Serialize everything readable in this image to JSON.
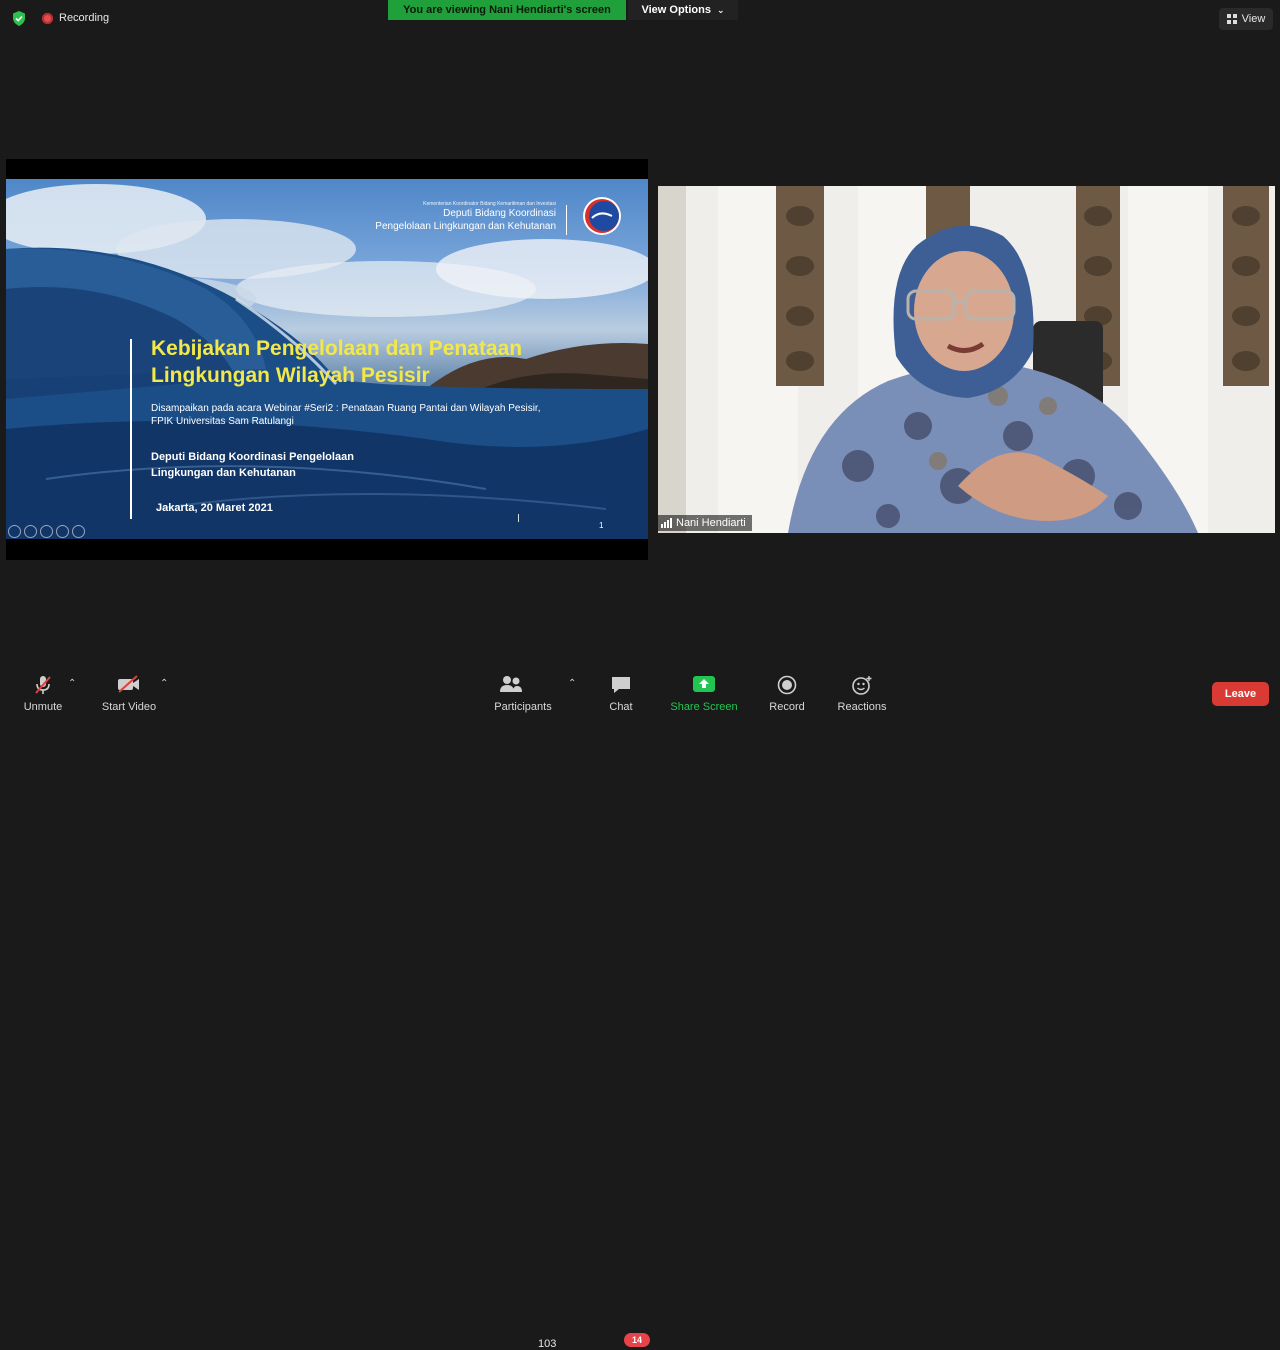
{
  "topbar": {
    "recording_label": "Recording",
    "viewing_banner": "You are viewing Nani Hendiarti's screen",
    "view_options_label": "View Options",
    "view_label": "View"
  },
  "slide": {
    "org_small": "Kementerian Koordinator Bidang Kemaritiman dan Investasi",
    "org_line1": "Deputi Bidang Koordinasi",
    "org_line2": "Pengelolaan Lingkungan dan Kehutanan",
    "title_line1": "Kebijakan Pengelolaan dan Penataan",
    "title_line2": "Lingkungan Wilayah Pesisir",
    "sub_line1": "Disampaikan pada acara Webinar #Seri2 : Penataan Ruang Pantai dan Wilayah Pesisir,",
    "sub_line2": "FPIK Universitas Sam Ratulangi",
    "dept_line1": "Deputi Bidang Koordinasi Pengelolaan",
    "dept_line2": "Lingkungan dan Kehutanan",
    "date": "Jakarta, 20 Maret 2021",
    "page_number": "1"
  },
  "participant": {
    "name": "Nani Hendiarti"
  },
  "toolbar": {
    "unmute": "Unmute",
    "start_video": "Start Video",
    "participants": "Participants",
    "participant_count": "103",
    "chat": "Chat",
    "chat_badge": "14",
    "share_screen": "Share Screen",
    "record": "Record",
    "reactions": "Reactions",
    "leave": "Leave"
  },
  "colors": {
    "banner_green": "#1fa03a",
    "leave_red": "#d93a34",
    "share_green": "#23c552",
    "title_yellow": "#f2e84a"
  }
}
